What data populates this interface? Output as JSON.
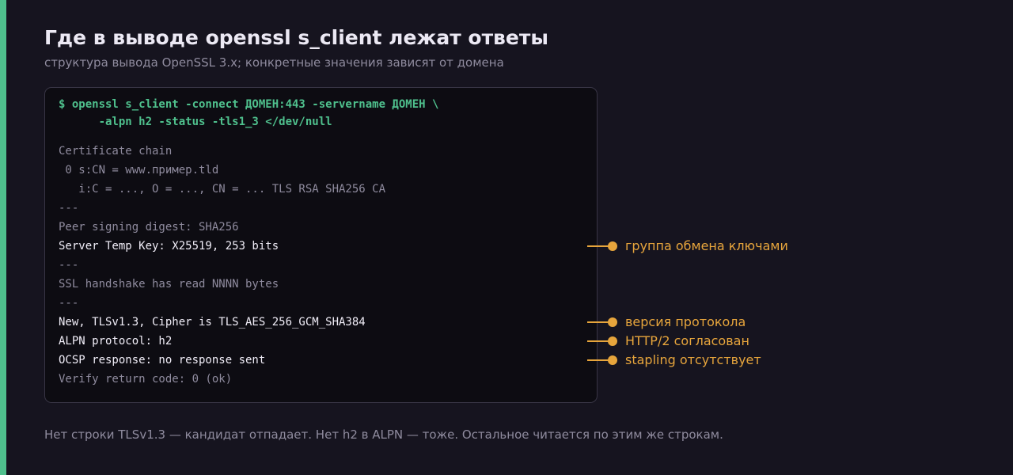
{
  "title": "Где в выводе openssl s_client лежат ответы",
  "subtitle": "структура вывода OpenSSL 3.x; конкретные значения зависят от домена",
  "terminal": {
    "command": [
      "$ openssl s_client -connect ДОМЕН:443 -servername ДОМЕН \\",
      "      -alpn h2 -status -tls1_3 </dev/null"
    ],
    "lines": [
      {
        "text": "Certificate chain",
        "highlight": false
      },
      {
        "text": " 0 s:CN = www.пример.tld",
        "highlight": false
      },
      {
        "text": "   i:C = ..., O = ..., CN = ... TLS RSA SHA256 CA",
        "highlight": false
      },
      {
        "text": "---",
        "highlight": false
      },
      {
        "text": "Peer signing digest: SHA256",
        "highlight": false
      },
      {
        "text": "Server Temp Key: X25519, 253 bits",
        "highlight": true
      },
      {
        "text": "---",
        "highlight": false
      },
      {
        "text": "SSL handshake has read NNNN bytes",
        "highlight": false
      },
      {
        "text": "---",
        "highlight": false
      },
      {
        "text": "New, TLSv1.3, Cipher is TLS_AES_256_GCM_SHA384",
        "highlight": true
      },
      {
        "text": "ALPN protocol: h2",
        "highlight": true
      },
      {
        "text": "OCSP response: no response sent",
        "highlight": true
      },
      {
        "text": "Verify return code: 0 (ok)",
        "highlight": false
      }
    ]
  },
  "annotations": [
    {
      "line": 5,
      "label": "группа обмена ключами"
    },
    {
      "line": 9,
      "label": "версия протокола"
    },
    {
      "line": 10,
      "label": "HTTP/2 согласован"
    },
    {
      "line": 11,
      "label": "stapling отсутствует"
    }
  ],
  "footer": "Нет строки TLSv1.3 — кандидат отпадает. Нет h2 в ALPN — тоже. Остальное читается по этим же строкам.",
  "colors": {
    "background": "#16141f",
    "accent_green": "#4fc08d",
    "annotation_orange": "#e7a53c",
    "terminal_bg": "#0d0c12",
    "dim_text": "#8f8b9e",
    "bright_text": "#f1eef8"
  }
}
